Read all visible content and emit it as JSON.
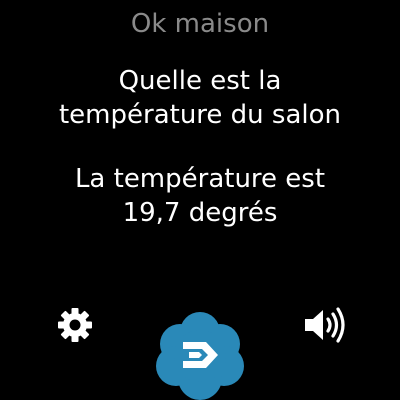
{
  "header": {
    "title": "Ok maison"
  },
  "conversation": {
    "query_lines": [
      "Quelle est la",
      "température du salon"
    ],
    "response_lines": [
      "La température est",
      "19,7 degrés"
    ]
  },
  "controls": {
    "settings_icon": "gear-icon",
    "volume_icon": "speaker-volume-icon",
    "mic_icon": "cloud-logo-icon"
  },
  "colors": {
    "background": "#000000",
    "title": "#8a8a8a",
    "text": "#ffffff",
    "accent": "#2a89b8"
  }
}
